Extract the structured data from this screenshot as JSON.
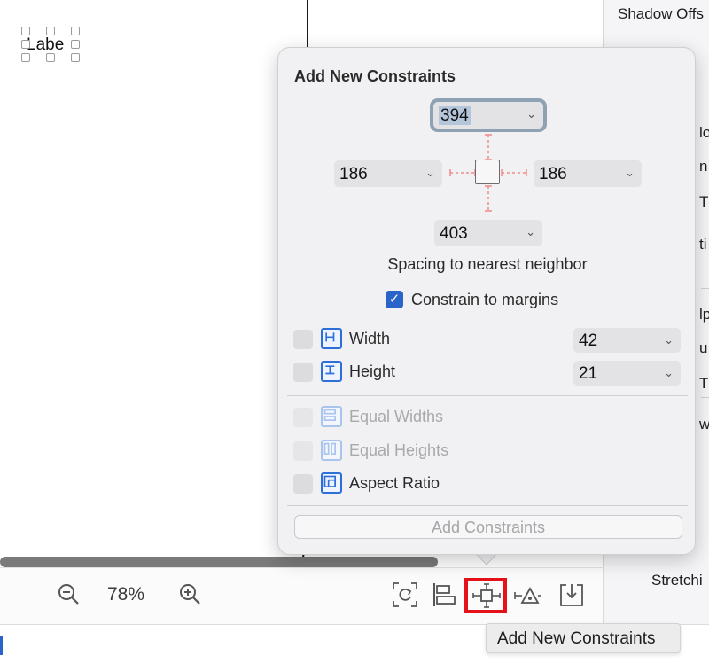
{
  "canvas": {
    "label_text": "Labe"
  },
  "inspector": {
    "items": [
      "Shadow Offs",
      "lo",
      "n",
      "T",
      "ti",
      "lp",
      "u",
      "T",
      "wi",
      "Stretchi"
    ]
  },
  "bottom_bar": {
    "zoom_level": "78%",
    "icons": [
      "zoom-out-icon",
      "zoom-in-icon",
      "update-frames-icon",
      "align-icon",
      "add-constraints-icon",
      "resolve-issues-icon",
      "embed-in-icon"
    ]
  },
  "tooltip": {
    "text": "Add New Constraints"
  },
  "popover": {
    "title": "Add New Constraints",
    "top_value": "394",
    "left_value": "186",
    "right_value": "186",
    "bottom_value": "403",
    "spacing_label": "Spacing to nearest neighbor",
    "constrain_margins_label": "Constrain to margins",
    "constrain_margins_checked": true,
    "rows": [
      {
        "label": "Width",
        "value": "42",
        "enabled": true,
        "icon": "width-icon"
      },
      {
        "label": "Height",
        "value": "21",
        "enabled": true,
        "icon": "height-icon"
      },
      {
        "label": "Equal Widths",
        "enabled": false,
        "icon": "equal-widths-icon"
      },
      {
        "label": "Equal Heights",
        "enabled": false,
        "icon": "equal-heights-icon"
      },
      {
        "label": "Aspect Ratio",
        "enabled": true,
        "icon": "aspect-ratio-icon"
      }
    ],
    "add_button_label": "Add Constraints"
  },
  "colors": {
    "highlight_red": "#e6121a",
    "accent_blue": "#2b64c8",
    "constraint_line": "#f08a8a"
  }
}
